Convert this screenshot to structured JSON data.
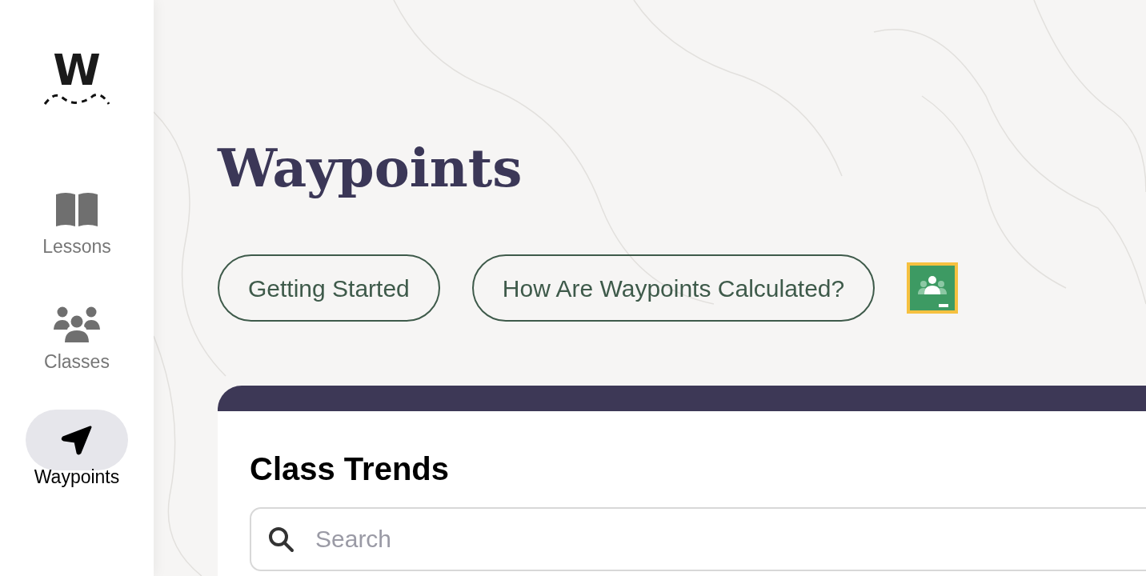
{
  "sidebar": {
    "logo": "W",
    "items": [
      {
        "kind": "book",
        "label": "Lessons",
        "selected": false
      },
      {
        "kind": "people",
        "label": "Classes",
        "selected": false
      },
      {
        "kind": "navigate",
        "label": "Waypoints",
        "selected": true
      }
    ]
  },
  "page": {
    "title": "Waypoints",
    "links": [
      "Getting Started",
      "How Are Waypoints Calculated?"
    ]
  },
  "card": {
    "title": "Class Trends",
    "search": {
      "placeholder": "Search"
    }
  }
}
